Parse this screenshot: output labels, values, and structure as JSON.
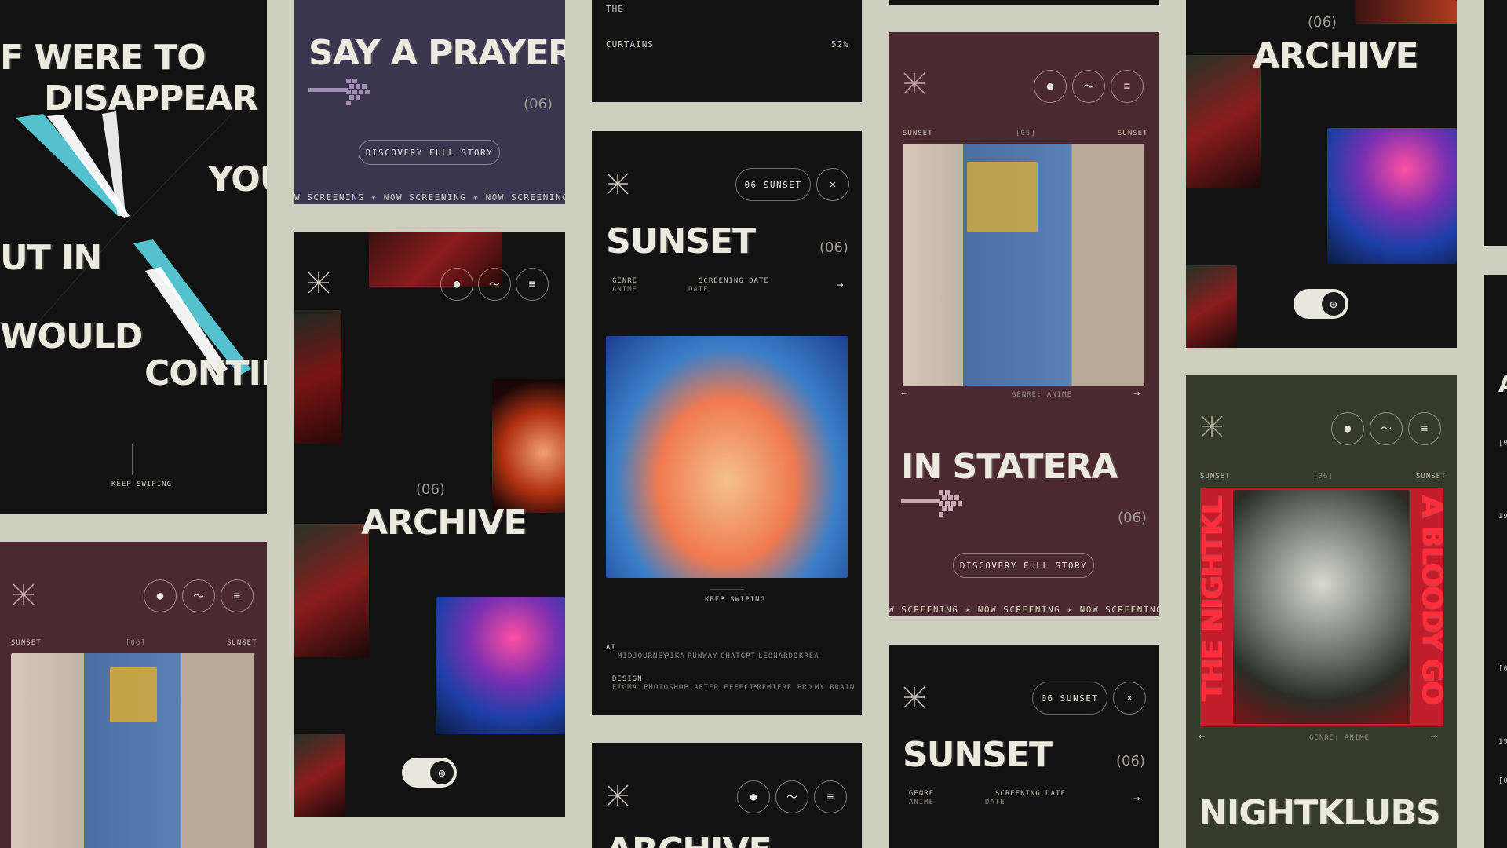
{
  "colors": {
    "background": "#cdd0bf",
    "dark": "#121212",
    "purple": "#3b3650",
    "maroon": "#4a2a30",
    "olive": "#353a2a",
    "text": "#e8e6dd"
  },
  "card_poem": {
    "lines": [
      "F WERE TO",
      "DISAPPEAR",
      "YOU",
      "UT IN",
      "WOULD",
      "CONTIN"
    ],
    "footer": "KEEP SWIPING"
  },
  "card_prayer": {
    "title": "SAY A PRAYER",
    "number": "(06)",
    "button": "DISCOVERY FULL STORY",
    "ticker": "W SCREENING ✳ NOW SCREENING ✳ NOW SCREENING"
  },
  "card_curtains": {
    "line1": "THE",
    "line2": "CURTAINS",
    "percent": "52%"
  },
  "card_sunset_main": {
    "pill": "06 SUNSET",
    "title": "SUNSET",
    "number": "(06)",
    "genre_label": "GENRE",
    "genre_value": "ANIME",
    "date_label": "SCREENING DATE",
    "date_value": "DATE",
    "footer": "KEEP SWIPING",
    "ai_label": "AI",
    "ai_tools": [
      "MIDJOURNEY",
      "PIKA",
      "RUNWAY",
      "CHATGPT",
      "LEONARDO",
      "KREA"
    ],
    "design_label": "DESIGN",
    "design_tools": [
      "FIGMA",
      "PHOTOSHOP",
      "AFTER EFFECTS",
      "PREMIERE PRO",
      "MY BRAIN"
    ]
  },
  "card_archive_mid": {
    "number": "(06)",
    "title": "ARCHIVE"
  },
  "card_archive_bottom": {
    "title": "ARCHIVE"
  },
  "card_statera": {
    "label_left": "SUNSET",
    "label_mid": "[06]",
    "label_right": "SUNSET",
    "genre": "GENRE: ANIME",
    "title": "IN STATERA",
    "number": "(06)",
    "button": "DISCOVERY FULL STORY",
    "ticker": "W SCREENING ✳ NOW SCREENING ✳ NOW SCREENING"
  },
  "card_sunset_lower": {
    "pill": "06 SUNSET",
    "title": "SUNSET",
    "number": "(06)",
    "genre_label": "GENRE",
    "genre_value": "ANIME",
    "date_label": "SCREENING DATE",
    "date_value": "DATE"
  },
  "card_archive_right": {
    "number": "(06)",
    "title": "ARCHIVE"
  },
  "card_nightklubs": {
    "label_left": "SUNSET",
    "label_mid": "[06]",
    "label_right": "SUNSET",
    "vertical_left": "THE NIGHTKL",
    "vertical_right": "A BLOODY GO",
    "genre": "GENRE: ANIME",
    "title": "NIGHTKLUBS"
  },
  "card_maroon_bottom_left": {
    "label_left": "SUNSET",
    "label_mid": "[06]",
    "label_right": "SUNSET"
  },
  "card_edge_right": {
    "items": [
      "A",
      "[0",
      "19",
      "[0",
      "19",
      "[0"
    ]
  },
  "icons": [
    "logo-icon",
    "eye-icon",
    "activity-icon",
    "menu-icon",
    "close-icon",
    "globe-icon",
    "arrow-right-icon",
    "arrow-left-icon"
  ]
}
